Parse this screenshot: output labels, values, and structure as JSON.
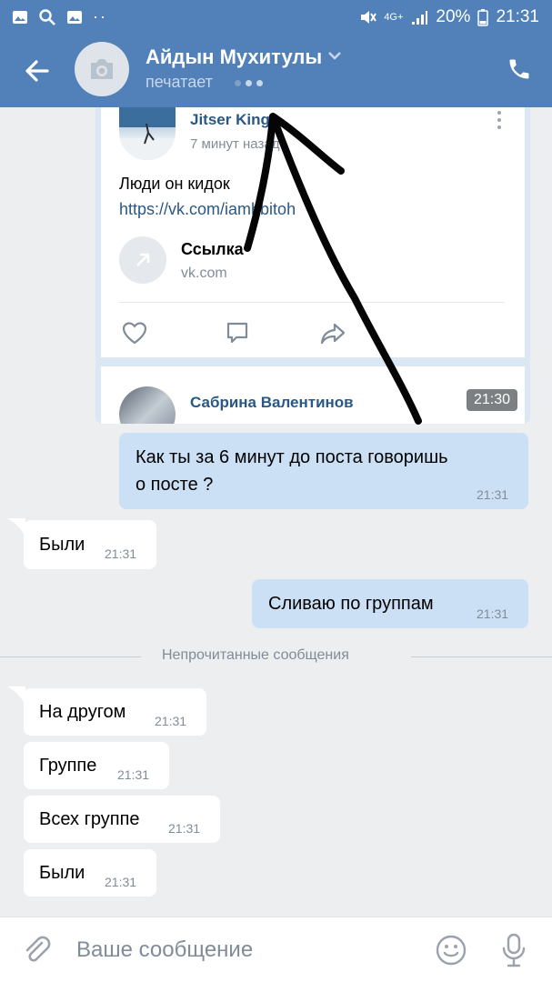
{
  "status_bar": {
    "battery": "20%",
    "time": "21:31",
    "network": "4G+"
  },
  "header": {
    "contact_name": "Айдын Мухитулы",
    "status": "печатает"
  },
  "forwarded": {
    "post1": {
      "author": "Jitser King",
      "time": "7 минут назад",
      "text": "Люди он кидок",
      "link": "https://vk.com/iamhbitoh",
      "link_title": "Ссылка",
      "link_domain": "vk.com"
    },
    "post2": {
      "author": "Сабрина Валентинов"
    },
    "time": "21:30"
  },
  "messages": [
    {
      "direction": "out",
      "text_line1": "Как ты за 6 минут до поста говоришь",
      "text_line2": "о посте ?",
      "time": "21:31"
    },
    {
      "direction": "in",
      "text": "Были",
      "time": "21:31"
    },
    {
      "direction": "out",
      "text": "Сливаю по группам",
      "time": "21:31"
    },
    {
      "direction": "in",
      "text": "На другом",
      "time": "21:31"
    },
    {
      "direction": "in",
      "text": "Группе",
      "time": "21:31"
    },
    {
      "direction": "in",
      "text": "Всех группе",
      "time": "21:31"
    },
    {
      "direction": "in",
      "text": "Были",
      "time": "21:31"
    }
  ],
  "divider": {
    "label": "Непрочитанные сообщения"
  },
  "composer": {
    "placeholder": "Ваше сообщение"
  },
  "colors": {
    "header": "#5181b8",
    "outgoing_bubble": "#cce0f5",
    "incoming_bubble": "#ffffff",
    "background": "#edeef0",
    "link": "#2a5885"
  },
  "icons": [
    "back-arrow-icon",
    "camera-icon",
    "chevron-down-icon",
    "phone-icon",
    "like-icon",
    "comment-icon",
    "share-icon",
    "link-arrow-icon",
    "attach-icon",
    "smile-icon",
    "mic-icon"
  ]
}
